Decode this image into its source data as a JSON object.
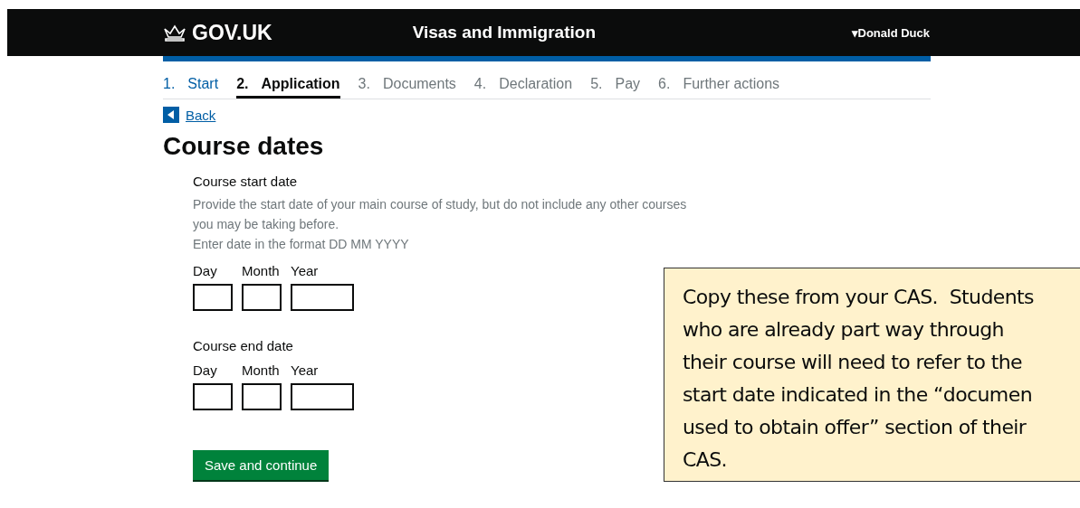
{
  "header": {
    "logo": "GOV.UK",
    "service": "Visas and Immigration",
    "user": "Donald Duck",
    "user_caret": "▾"
  },
  "steps": [
    {
      "number": "1.",
      "label": "Start",
      "selected": false,
      "disabled": false
    },
    {
      "number": "2.",
      "label": "Application",
      "selected": true,
      "disabled": false
    },
    {
      "number": "3.",
      "label": "Documents",
      "selected": false,
      "disabled": true
    },
    {
      "number": "4.",
      "label": "Declaration",
      "selected": false,
      "disabled": true
    },
    {
      "number": "5.",
      "label": "Pay",
      "selected": false,
      "disabled": true
    },
    {
      "number": "6.",
      "label": "Further actions",
      "selected": false,
      "disabled": true
    }
  ],
  "back_link": "Back",
  "title": "Course dates",
  "fields": [
    {
      "label": "Course start date",
      "hints": [
        "Provide the start date of your main course of study, but do not include any other courses you may be taking before.",
        "Enter date in the format DD MM YYYY"
      ],
      "parts": [
        "Day",
        "Month",
        "Year"
      ]
    },
    {
      "label": "Course end date",
      "parts": [
        "Day",
        "Month",
        "Year"
      ]
    }
  ],
  "submit_button": "Save and continue",
  "callout": {
    "lines": [
      "Copy these from your CAS.  Students",
      "who are already part way through",
      "their course will need to refer to the",
      "start date indicated in the “documen",
      "used to obtain offer” section of their",
      "CAS."
    ]
  }
}
